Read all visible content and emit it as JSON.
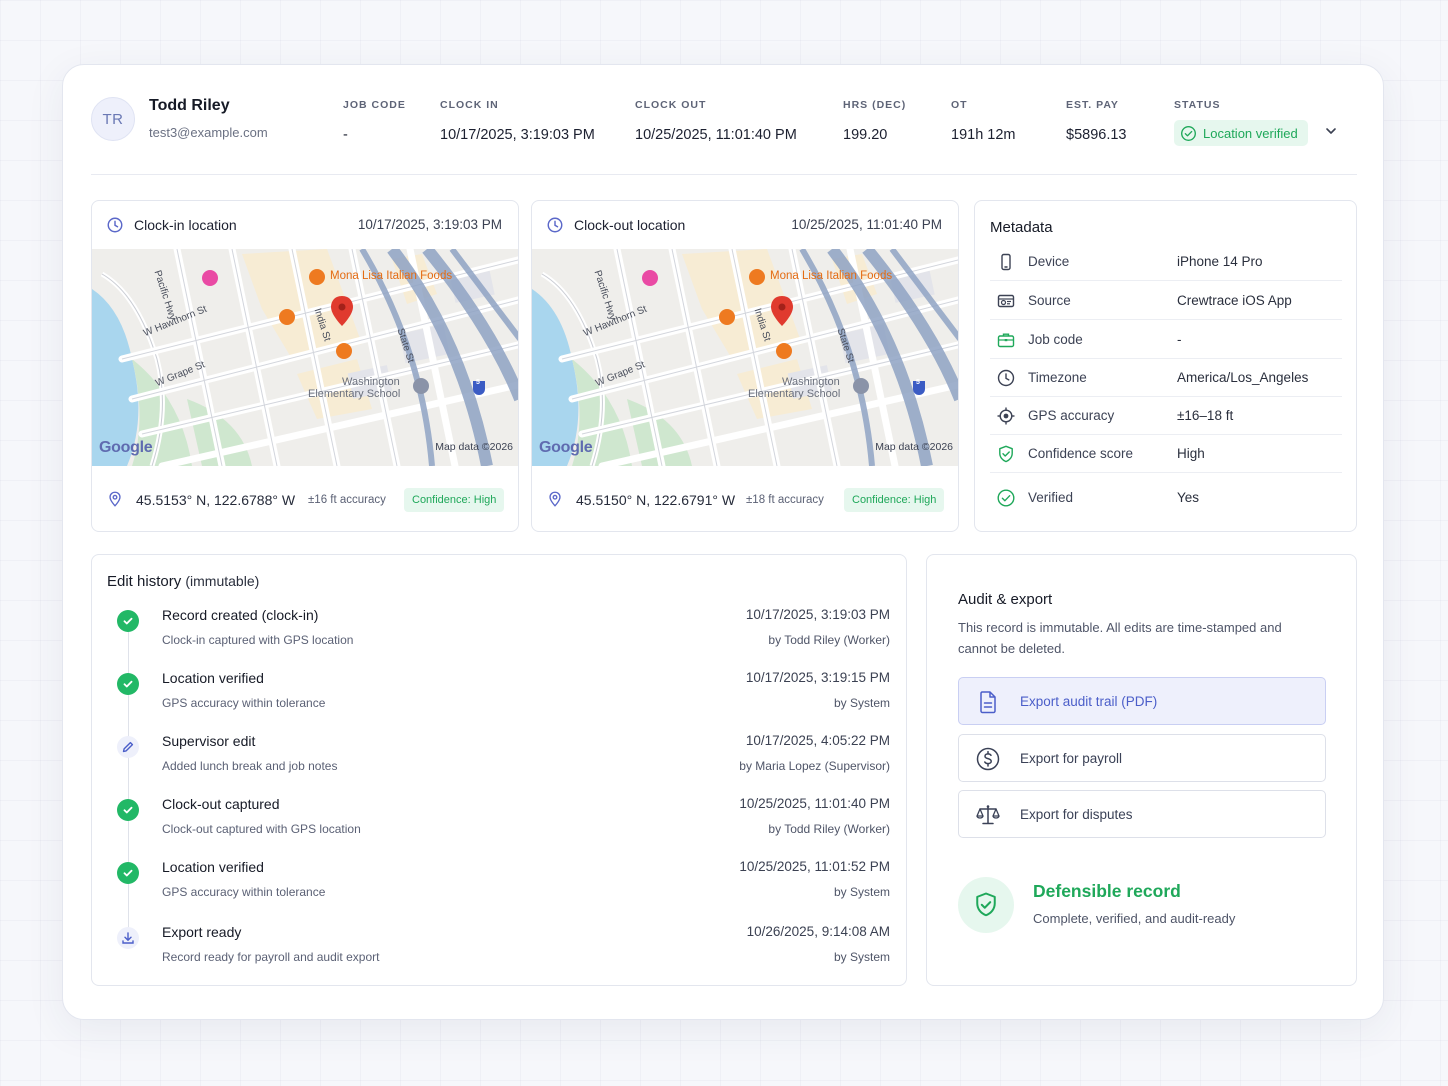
{
  "header": {
    "avatar_initials": "TR",
    "name": "Todd Riley",
    "email": "test3@example.com",
    "columns": [
      {
        "label": "JOB CODE",
        "value": "-"
      },
      {
        "label": "CLOCK IN",
        "value": "10/17/2025, 3:19:03 PM"
      },
      {
        "label": "CLOCK OUT",
        "value": "10/25/2025, 11:01:40 PM"
      },
      {
        "label": "HRS (DEC)",
        "value": "199.20"
      },
      {
        "label": "OT",
        "value": "191h 12m"
      },
      {
        "label": "EST. PAY",
        "value": "$5896.13"
      },
      {
        "label": "STATUS",
        "value": ""
      }
    ],
    "status_badge": "Location verified"
  },
  "clock_in": {
    "title": "Clock-in location",
    "time": "10/17/2025, 3:19:03 PM",
    "coords": "45.5153° N, 122.6788° W",
    "accuracy": "±16 ft accuracy",
    "confidence": "Confidence: High"
  },
  "clock_out": {
    "title": "Clock-out location",
    "time": "10/25/2025, 11:01:40 PM",
    "coords": "45.5150° N, 122.6791° W",
    "accuracy": "±18 ft accuracy",
    "confidence": "Confidence: High"
  },
  "map_labels": {
    "restaurant": "Mona Lisa Italian Foods",
    "pacific_hwy": "Pacific Hwy",
    "hawthorn": "W Hawthorn St",
    "grape": "W Grape St",
    "india": "India St",
    "state": "State St",
    "school_1": "Washington",
    "school_2": "Elementary School",
    "google": "Google",
    "map_data": "Map data ©2026",
    "shield": "5"
  },
  "metadata": {
    "title": "Metadata",
    "rows": [
      {
        "icon": "phone-icon",
        "key": "Device",
        "value": "iPhone 14 Pro"
      },
      {
        "icon": "source-icon",
        "key": "Source",
        "value": "Crewtrace iOS App"
      },
      {
        "icon": "briefcase-icon",
        "key": "Job code",
        "value": "-"
      },
      {
        "icon": "clock-icon",
        "key": "Timezone",
        "value": "America/Los_Angeles"
      },
      {
        "icon": "target-icon",
        "key": "GPS accuracy",
        "value": "±16–18 ft"
      },
      {
        "icon": "shield-check-icon",
        "key": "Confidence score",
        "value": "High"
      },
      {
        "icon": "check-circle-icon",
        "key": "Verified",
        "value": "Yes"
      }
    ]
  },
  "history": {
    "title": "Edit history",
    "title_sub": "(immutable)",
    "events": [
      {
        "type": "check",
        "title": "Record created (clock-in)",
        "sub": "Clock-in captured with GPS location",
        "date": "10/17/2025, 3:19:03 PM",
        "by": "by Todd Riley (Worker)"
      },
      {
        "type": "check",
        "title": "Location verified",
        "sub": "GPS accuracy within tolerance",
        "date": "10/17/2025, 3:19:15 PM",
        "by": "by System"
      },
      {
        "type": "edit",
        "title": "Supervisor edit",
        "sub": "Added lunch break and job notes",
        "date": "10/17/2025, 4:05:22 PM",
        "by": "by Maria Lopez (Supervisor)"
      },
      {
        "type": "check",
        "title": "Clock-out captured",
        "sub": "Clock-out captured with GPS location",
        "date": "10/25/2025, 11:01:40 PM",
        "by": "by Todd Riley (Worker)"
      },
      {
        "type": "check",
        "title": "Location verified",
        "sub": "GPS accuracy within tolerance",
        "date": "10/25/2025, 11:01:52 PM",
        "by": "by System"
      },
      {
        "type": "download",
        "title": "Export ready",
        "sub": "Record ready for payroll and audit export",
        "date": "10/26/2025, 9:14:08 AM",
        "by": "by System"
      }
    ]
  },
  "audit": {
    "title": "Audit & export",
    "description": "This record is immutable. All edits are time-stamped and cannot be deleted.",
    "buttons": [
      {
        "icon": "document-icon",
        "label": "Export audit trail (PDF)"
      },
      {
        "icon": "dollar-icon",
        "label": "Export for payroll"
      },
      {
        "icon": "scale-icon",
        "label": "Export for disputes"
      }
    ],
    "defensible_title": "Defensible record",
    "defensible_sub": "Complete, verified, and audit-ready"
  },
  "colors": {
    "accent_green": "#1fa85a",
    "accent_blue": "#4b5ec9",
    "map_pin_red": "#e03a2e",
    "map_poi_orange": "#ee7a20"
  }
}
